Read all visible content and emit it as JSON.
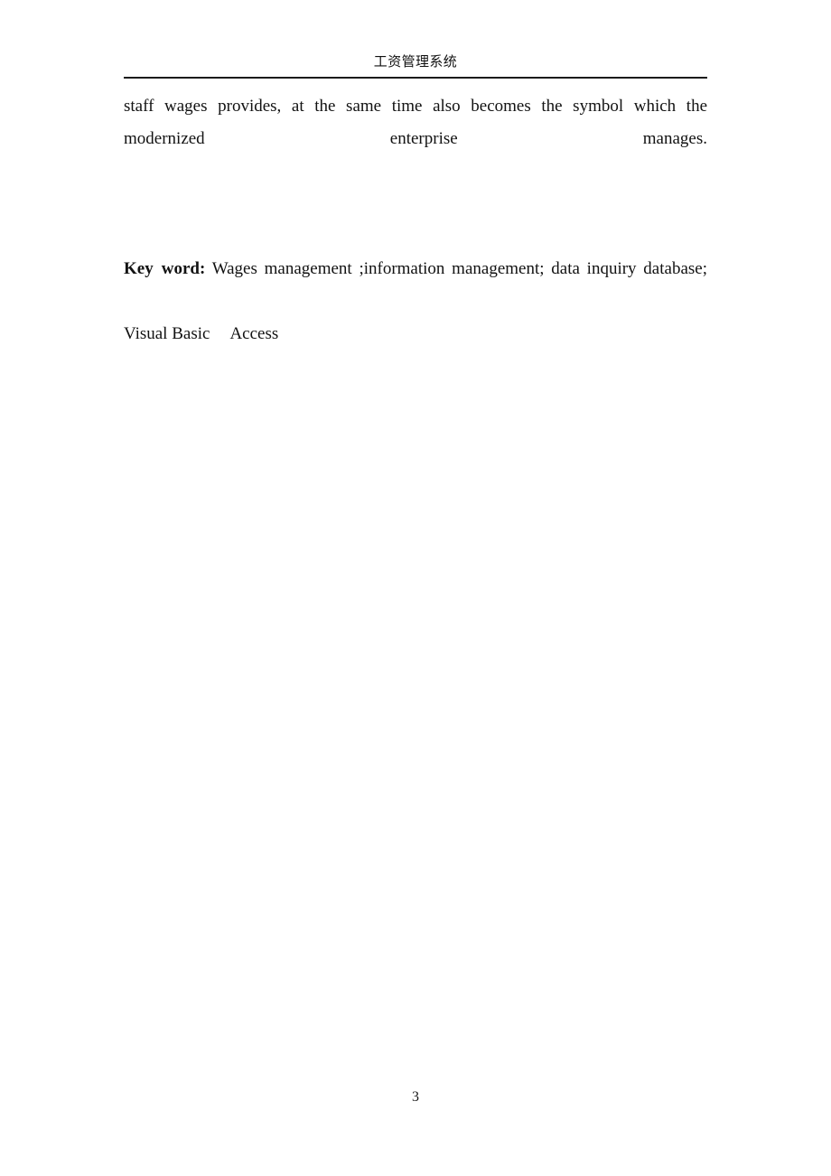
{
  "document": {
    "header": {
      "title": "工资管理系统"
    },
    "body": {
      "abstract_tail": "staff wages provides, at the same time also becomes the symbol which the modernized enterprise manages.",
      "keyword_label": "Key",
      "keyword_label_2": "word:",
      "keyword_text": "Wages management ;information management; data inquiry database;",
      "keyword_line2_a": "Visual Basic",
      "keyword_line2_b": "Access"
    },
    "footer": {
      "page_number": "3"
    },
    "colors": {
      "page_background": "#ffffff",
      "text": "#121212",
      "rule": "#1b1b1b"
    }
  }
}
